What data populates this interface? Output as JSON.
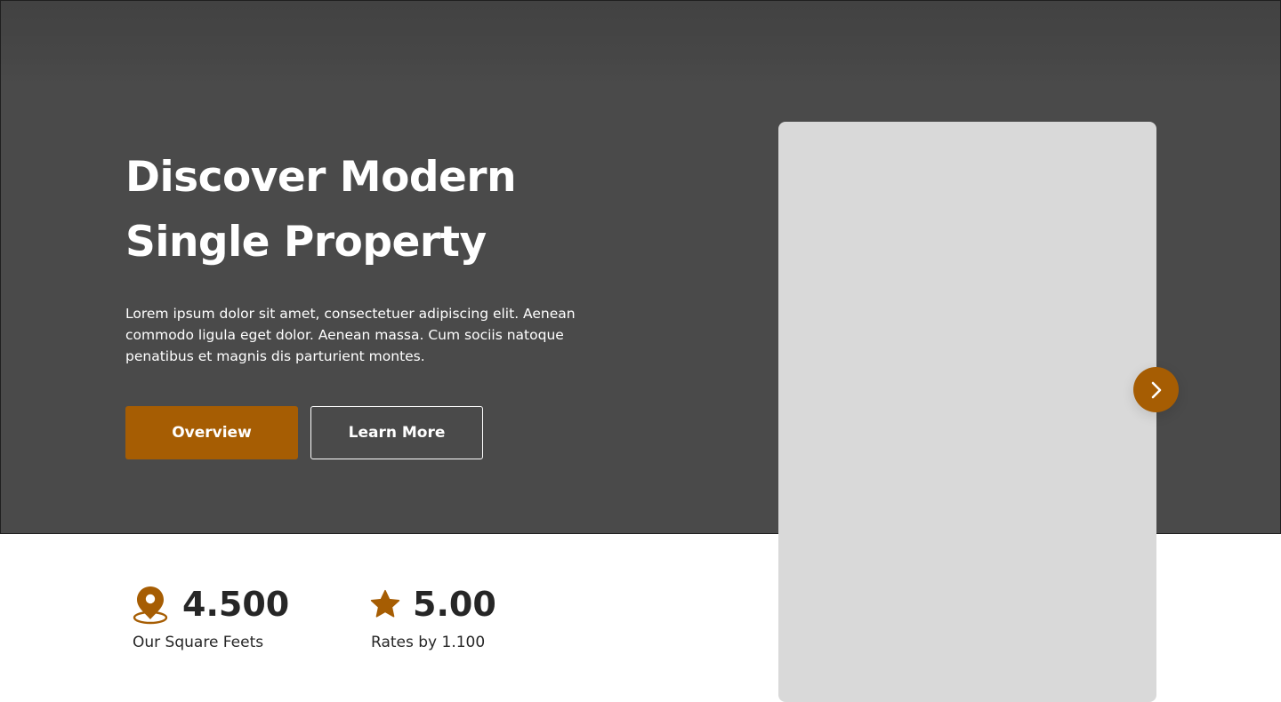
{
  "hero": {
    "title_line1": "Discover Modern",
    "title_line2": "Single Property",
    "description": "Lorem ipsum dolor sit amet, consectetuer adipiscing elit. Aenean commodo ligula eget dolor. Aenean massa. Cum sociis natoque penatibus et magnis dis parturient montes.",
    "buttons": {
      "overview_label": "Overview",
      "learn_more_label": "Learn More"
    }
  },
  "carousel": {
    "next_icon": "chevron-right-icon"
  },
  "stats": [
    {
      "icon": "map-pin-icon",
      "value": "4.500",
      "label": "Our Square Feets"
    },
    {
      "icon": "star-icon",
      "value": "5.00",
      "label": "Rates by 1.100"
    }
  ],
  "colors": {
    "accent": "#a65d03",
    "hero_bg": "#4a4a4a",
    "card_placeholder": "#d9d9d9",
    "text_dark": "#262626"
  }
}
